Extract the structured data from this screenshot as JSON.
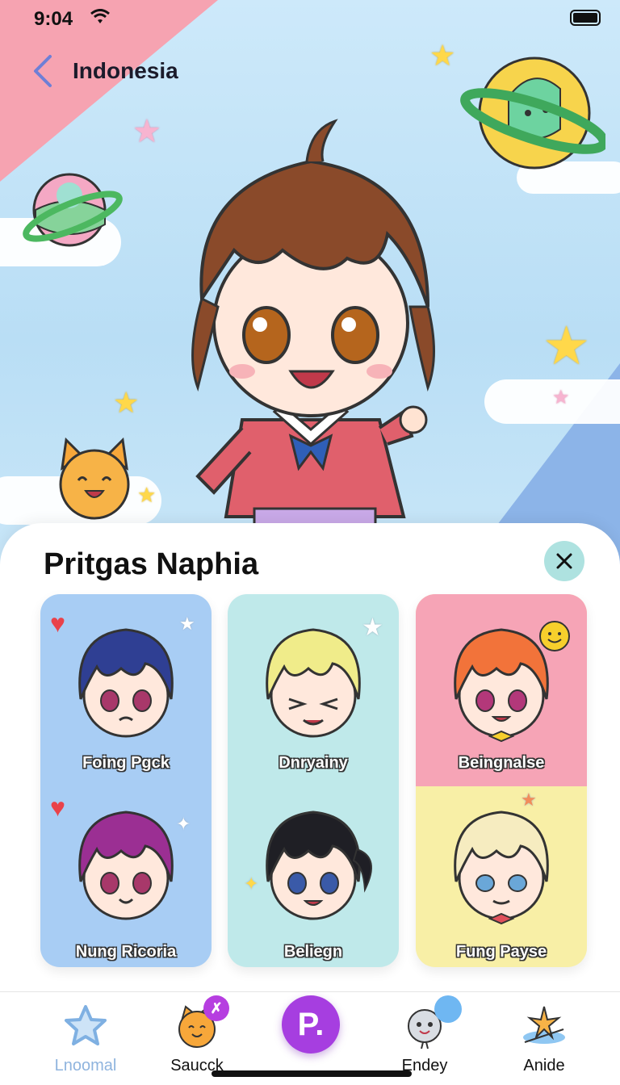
{
  "status_bar": {
    "time": "9:04"
  },
  "header": {
    "title": "Indonesia"
  },
  "sheet": {
    "title": "Pritgas Naphia"
  },
  "cards": [
    {
      "label": "Foing Pgck",
      "hair": "#2f3f93",
      "bg": "#a8cdf4",
      "eyes": "#a8386a"
    },
    {
      "label": "Nung Ricoria",
      "hair": "#9b2f93",
      "bg": "#a8cdf4",
      "eyes": "#a8386a"
    },
    {
      "label": "Dnryainy",
      "hair": "#f0ec8a",
      "bg": "#bfe9ea",
      "eyes": "#333333"
    },
    {
      "label": "Beliegn",
      "hair": "#1f1f25",
      "bg": "#bfe9ea",
      "eyes": "#3a5aa8"
    },
    {
      "label": "Beingnalse",
      "hair": "#f2733a",
      "bg": "#f6a4b6",
      "eyes": "#b3387a"
    },
    {
      "label": "Fung Payse",
      "hair": "#f6ecc0",
      "bg": "#f8efa6",
      "eyes": "#6aa7d8"
    }
  ],
  "tabs": [
    {
      "label": "Lnoomal",
      "icon": "star-icon",
      "active": false
    },
    {
      "label": "Saucck",
      "icon": "mascot-icon",
      "badge": "✗"
    },
    {
      "label": "P.",
      "icon": "profile-icon"
    },
    {
      "label": "Endey",
      "icon": "ghost-icon"
    },
    {
      "label": "Anide",
      "icon": "sparkle-icon"
    }
  ],
  "colors": {
    "accent": "#a63ee0",
    "sheet_close_bg": "#aee2e0",
    "heart": "#e9424a"
  }
}
